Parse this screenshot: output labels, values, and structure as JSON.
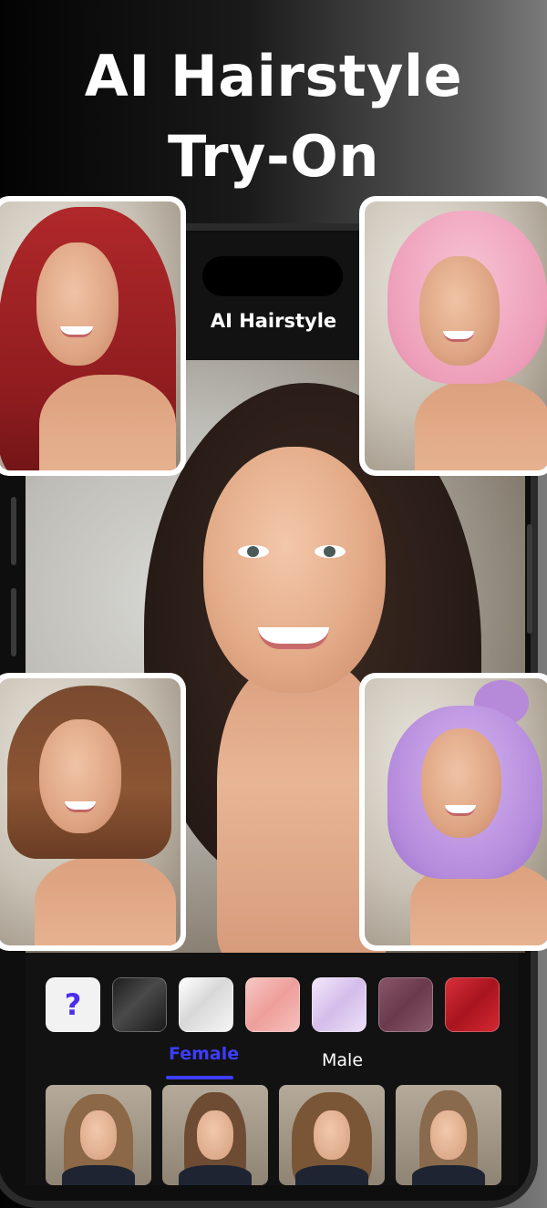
{
  "headline": {
    "line1": "AI Hairstyle",
    "line2": "Try-On"
  },
  "app": {
    "title": "AI Hairstyle"
  },
  "palette": {
    "help_symbol": "?",
    "colors": [
      "#f2f2f2",
      "#2e2e2e",
      "#eeeeee",
      "#f2b3b0",
      "#e2d2f0",
      "#7c4a5c",
      "#c21f2a"
    ]
  },
  "tabs": {
    "female": "Female",
    "male": "Male",
    "selected": "Female"
  },
  "accent_color": "#3d3dff"
}
